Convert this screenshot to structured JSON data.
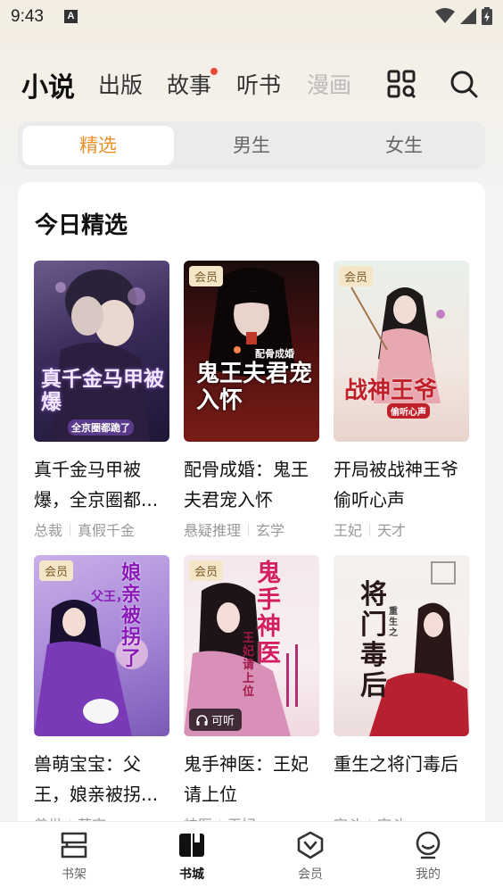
{
  "status": {
    "time": "9:43",
    "notif": "A"
  },
  "nav": {
    "tabs": [
      "小说",
      "出版",
      "故事",
      "听书",
      "漫画"
    ],
    "active": "小说",
    "story_dot_color": "#f04a3a"
  },
  "segment": {
    "items": [
      "精选",
      "男生",
      "女生"
    ],
    "active": "精选",
    "accent": "#e8902a"
  },
  "section": {
    "title": "今日精选",
    "books": [
      {
        "title": "真千金马甲被爆，全京圈都...",
        "tags": [
          "总裁",
          "真假千金"
        ],
        "badge": "",
        "cover_text": "真千金马甲被爆",
        "cover_sub": "全京圈都跪了",
        "audio": ""
      },
      {
        "title": "配骨成婚：鬼王夫君宠入怀",
        "tags": [
          "悬疑推理",
          "玄学"
        ],
        "badge": "会员",
        "cover_text": "鬼王夫君宠入怀",
        "cover_sub": "配骨成婚",
        "audio": ""
      },
      {
        "title": "开局被战神王爷偷听心声",
        "tags": [
          "王妃",
          "天才"
        ],
        "badge": "会员",
        "cover_text": "战神王爷",
        "cover_sub": "偷听心声",
        "audio": ""
      },
      {
        "title": "兽萌宝宝：父王，娘亲被拐...",
        "tags": [
          "兽世",
          "萌宝"
        ],
        "badge": "会员",
        "cover_text": "娘亲被拐了",
        "cover_sub": "父王，",
        "audio": ""
      },
      {
        "title": "鬼手神医：王妃请上位",
        "tags": [
          "神医",
          "王妃"
        ],
        "badge": "会员",
        "cover_text": "鬼手神医",
        "cover_sub": "王妃请上位",
        "audio": "可听"
      },
      {
        "title": "重生之将门毒后",
        "tags": [
          "宫斗",
          "宫斗"
        ],
        "badge": "",
        "cover_text": "将门毒后",
        "cover_sub": "重生之",
        "audio": ""
      }
    ]
  },
  "bottom": {
    "items": [
      "书架",
      "书城",
      "会员",
      "我的"
    ],
    "active": "书城"
  }
}
